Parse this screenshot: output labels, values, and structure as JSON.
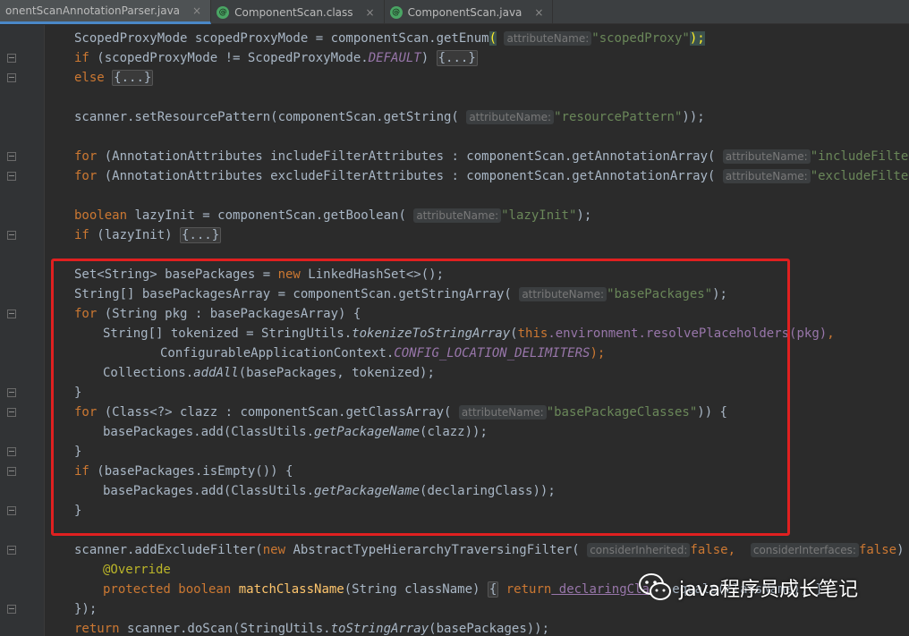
{
  "tabs": [
    {
      "label": "onentScanAnnotationParser.java",
      "active": true
    },
    {
      "label": "ComponentScan.class",
      "active": false
    },
    {
      "label": "ComponentScan.java",
      "active": false
    }
  ],
  "tab_close_glyph": "×",
  "tab_file_icon_letter": "@",
  "code": {
    "l1": {
      "a": "ScopedProxyMode scopedProxyMode = componentScan.getEnum",
      "paren": "(",
      "hint": "attributeName:",
      "s": "\"scopedProxy\"",
      "b": ");"
    },
    "l2": {
      "kw": "if",
      "a": " (scopedProxyMode != ScopedProxyMode.",
      "st": "DEFAULT",
      "b": ") ",
      "fold": "{...}"
    },
    "l3": {
      "kw": "else",
      "fold": "{...}"
    },
    "l5": {
      "a": "scanner.setResourcePattern(componentScan.getString(",
      "hint": "attributeName:",
      "s": "\"resourcePattern\"",
      "b": "));"
    },
    "l7": {
      "kw": "for",
      "a": " (AnnotationAttributes includeFilterAttributes : componentScan.getAnnotationArray(",
      "hint": "attributeName:",
      "s": "\"includeFilters\"",
      "b": "))"
    },
    "l8": {
      "kw": "for",
      "a": " (AnnotationAttributes excludeFilterAttributes : componentScan.getAnnotationArray(",
      "hint": "attributeName:",
      "s": "\"excludeFilters\"",
      "b": "))"
    },
    "l10": {
      "kw": "boolean",
      "a": " lazyInit = componentScan.getBoolean(",
      "hint": "attributeName:",
      "s": "\"lazyInit\"",
      "b": ");"
    },
    "l11": {
      "kw": "if",
      "a": " (lazyInit) ",
      "fold": "{...}"
    },
    "l13": {
      "a": "Set<String> basePackages = ",
      "kw": "new",
      "b": " LinkedHashSet<>();"
    },
    "l14": {
      "a": "String[] basePackagesArray = componentScan.getStringArray(",
      "hint": "attributeName:",
      "s": "\"basePackages\"",
      "b": ");"
    },
    "l15": {
      "kw": "for",
      "a": " (String pkg : basePackagesArray) {"
    },
    "l16": {
      "a": "String[] tokenized = StringUtils.",
      "it": "tokenizeToStringArray",
      "b": "(",
      "kw": "this",
      "c": ".environment.resolvePlaceholders(pkg)",
      "d": ","
    },
    "l17": {
      "a": "ConfigurableApplicationContext.",
      "st": "CONFIG_LOCATION_DELIMITERS",
      "b": ");"
    },
    "l18": {
      "a": "Collections.",
      "it": "addAll",
      "b": "(basePackages, tokenized);"
    },
    "l19": {
      "a": "}"
    },
    "l20": {
      "kw": "for",
      "a": " (Class<?> clazz : componentScan.getClassArray(",
      "hint": "attributeName:",
      "s": "\"basePackageClasses\"",
      "b": ")) {"
    },
    "l21": {
      "a": "basePackages.add(ClassUtils.",
      "it": "getPackageName",
      "b": "(clazz));"
    },
    "l22": {
      "a": "}"
    },
    "l23": {
      "kw": "if",
      "a": " (basePackages.isEmpty()) {"
    },
    "l24": {
      "a": "basePackages.add(ClassUtils.",
      "it": "getPackageName",
      "b": "(declaringClass));"
    },
    "l25": {
      "a": "}"
    },
    "l27": {
      "a": "scanner.addExcludeFilter(",
      "kw": "new",
      "b": " AbstractTypeHierarchyTraversingFilter(",
      "hint1": "considerInherited:",
      "kw2": "false",
      "c": ",  ",
      "hint2": "considerInterfaces:",
      "kw3": "false",
      "d": ") {"
    },
    "l28": {
      "ann": "@Override"
    },
    "l29": {
      "kw": "protected boolean",
      "fn": " matchClassName",
      "a": "(String className) ",
      "fold": "{",
      "kw2": " return",
      "ul": " declaringClass",
      "b": ".equals(className); }"
    },
    "l30": {
      "a": "});"
    },
    "l31": {
      "kw": "return",
      "a": " scanner.doScan(StringUtils.",
      "it": "toStringArray",
      "b": "(basePackages));"
    }
  },
  "watermark": {
    "text": "java程序员成长笔记",
    "icon": "wechat-icon"
  },
  "colors": {
    "highlight_box": "#e02020",
    "background": "#2b2b2b",
    "keyword": "#cc7832",
    "string": "#6a8759"
  }
}
